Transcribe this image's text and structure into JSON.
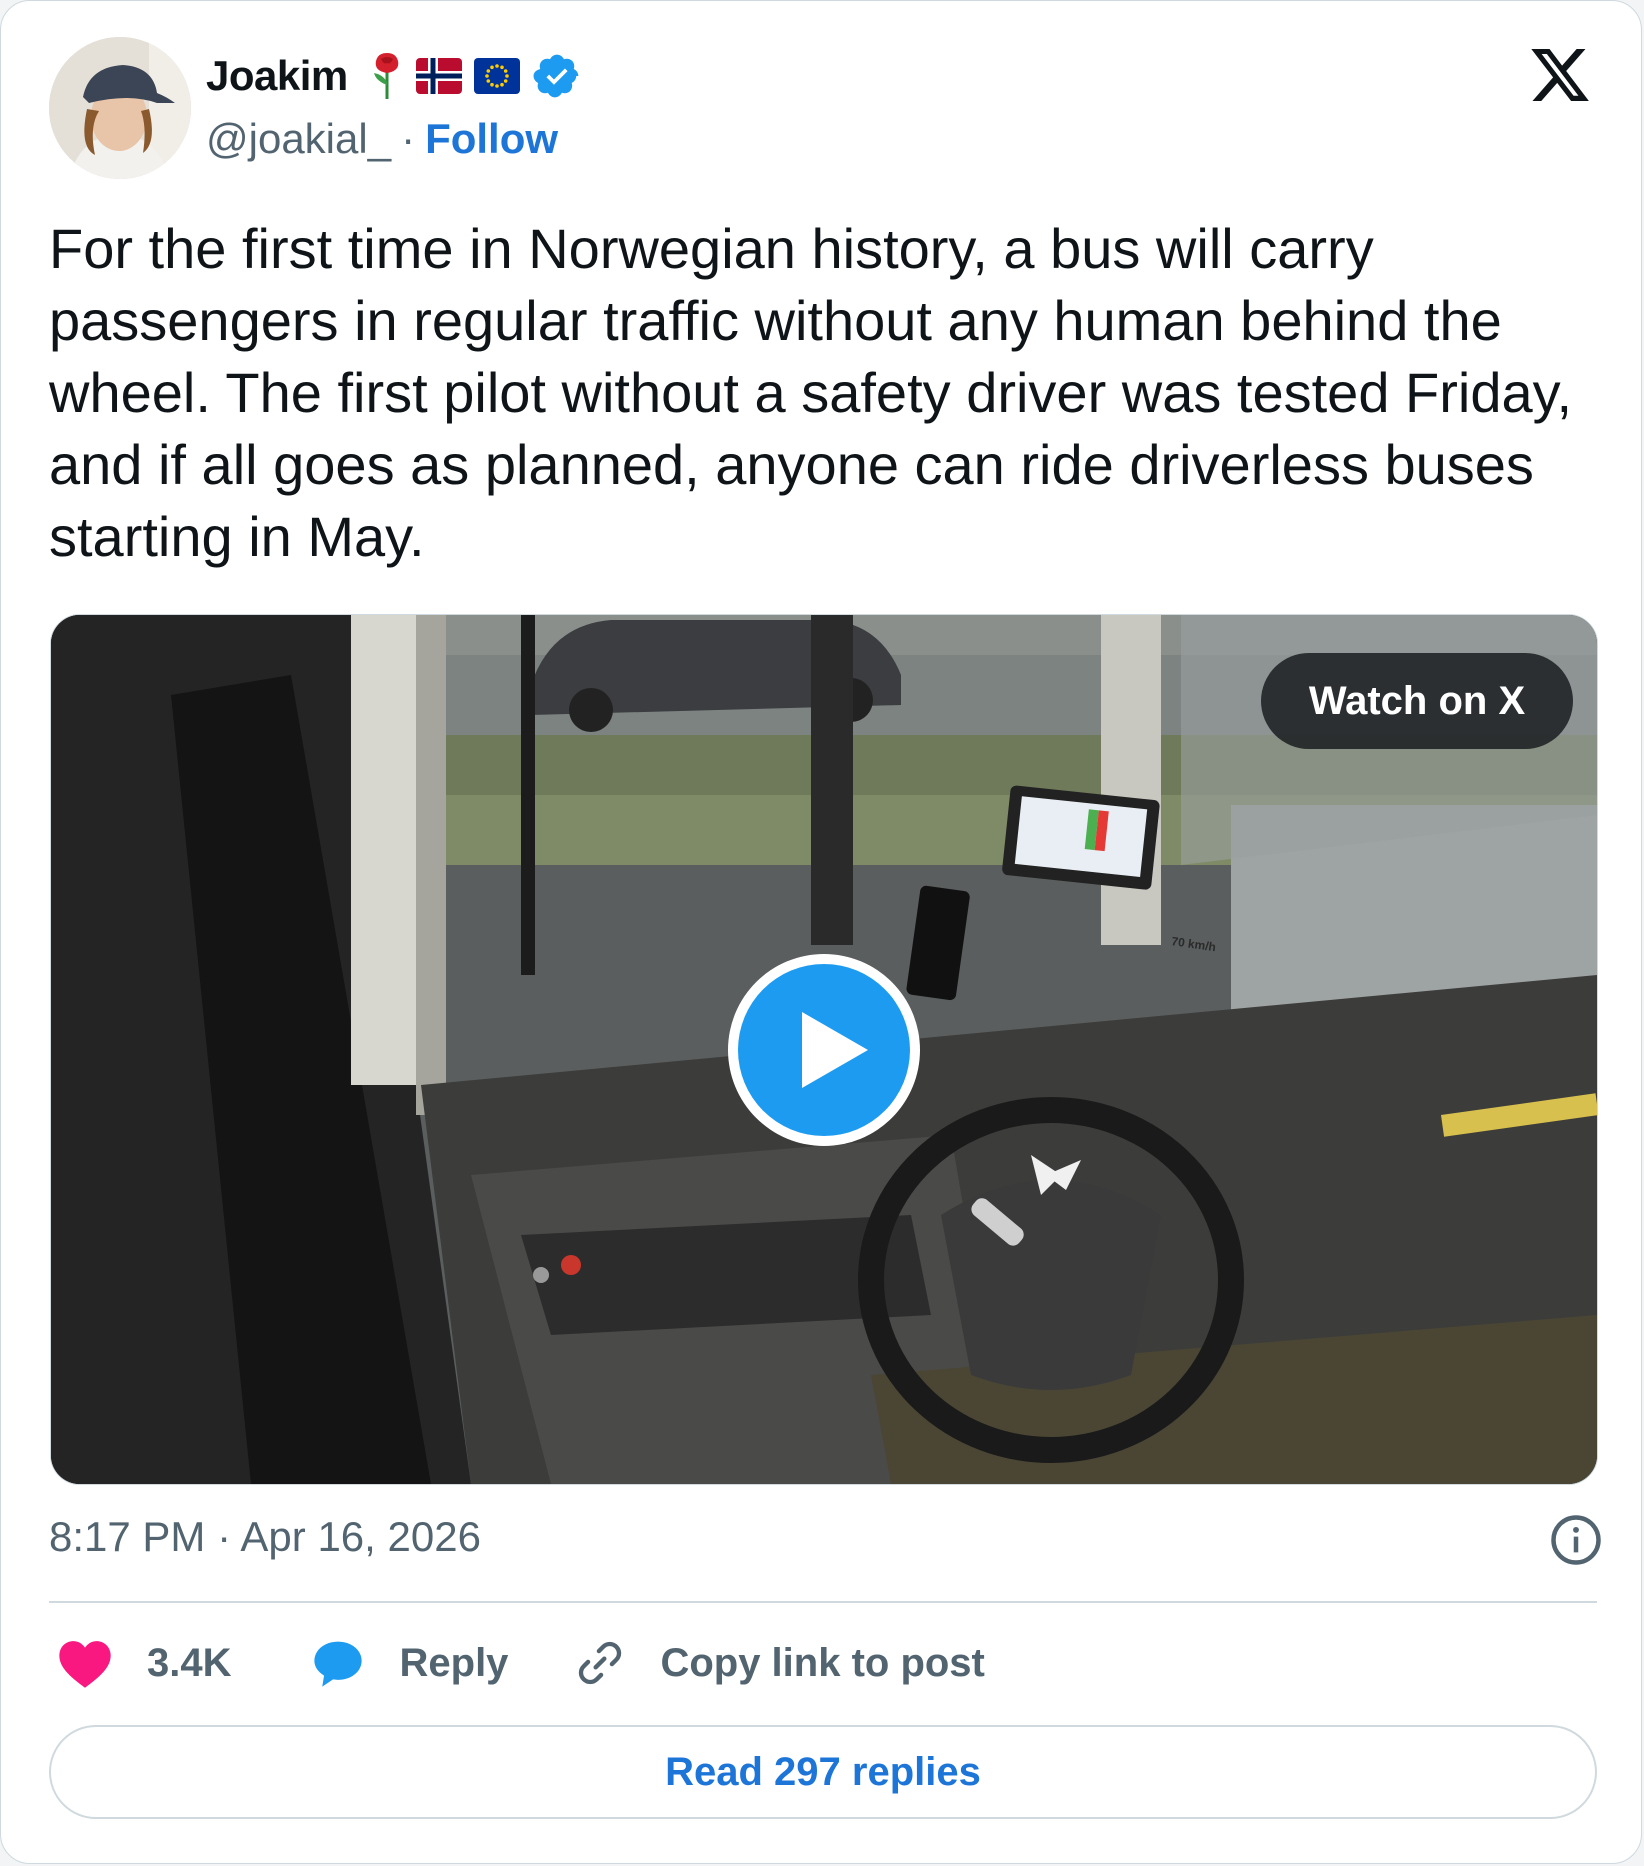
{
  "author": {
    "name": "Joakim",
    "handle": "@joakial_",
    "separator": "·",
    "follow_label": "Follow",
    "badges": [
      "rose-emoji",
      "norway-flag-emoji",
      "eu-flag-emoji",
      "verified-badge"
    ]
  },
  "post": {
    "text": "For the first time in Norwegian history, a bus will carry passengers in regular traffic without any human behind the wheel. The first pilot without a safety driver was tested Friday, and if all goes as planned, anyone can ride driverless buses starting in May.",
    "timestamp": "8:17 PM · Apr 16, 2026"
  },
  "media": {
    "watch_label": "Watch on X",
    "play_icon": "play-icon",
    "sign_text": "70 km/h"
  },
  "actions": {
    "likes": "3.4K",
    "reply_label": "Reply",
    "copy_label": "Copy link to post"
  },
  "footer": {
    "read_replies_label": "Read 297 replies"
  },
  "colors": {
    "accent": "#1d9bf0",
    "link": "#1d75d8",
    "like": "#f91880",
    "muted": "#536471",
    "border": "#cfd9de"
  }
}
